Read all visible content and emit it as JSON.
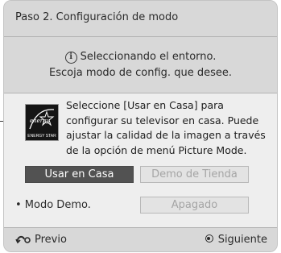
{
  "dialog": {
    "title": "Paso 2. Configuración de modo",
    "info_line1": "Seleccionando el entorno.",
    "info_line2": "Escoja modo de config. que desee.",
    "description": "Seleccione [Usar en Casa] para configurar su televisor en casa. Puede ajustar la calidad de la imagen a través de la opción de menú Picture Mode.",
    "energy_logo_text": "ENERGY STAR",
    "energy_logo_script": "energy",
    "buttons": {
      "home": "Usar en Casa",
      "store_demo": "Demo de Tienda"
    },
    "demo_mode": {
      "label": "• Modo Demo.",
      "value": "Apagado"
    },
    "footer": {
      "previous": "Previo",
      "next": "Siguiente"
    }
  },
  "colors": {
    "selected_button": "#525252",
    "disabled_button": "#e3e3e3",
    "panel": "#d8d8d8",
    "content": "#eeeeee"
  }
}
